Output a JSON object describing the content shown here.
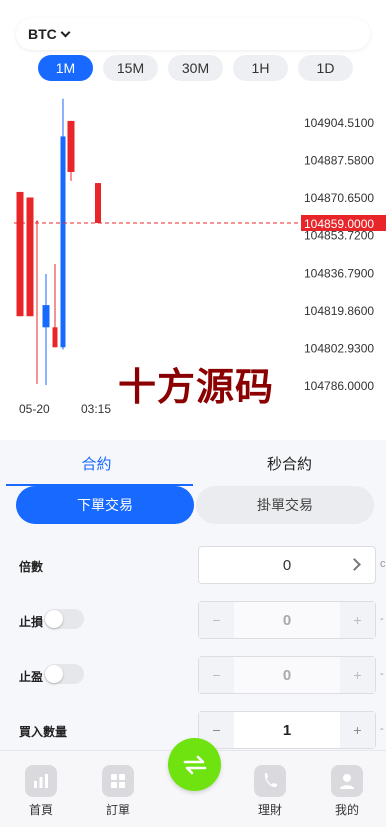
{
  "header": {
    "symbol": "BTC"
  },
  "timeframes": [
    "1M",
    "15M",
    "30M",
    "1H",
    "1D"
  ],
  "active_timeframe": "1M",
  "chart_data": {
    "type": "candlestick",
    "y_ticks": [
      "104904.5100",
      "104887.5800",
      "104870.6500",
      "104853.7200",
      "104836.7900",
      "104819.8600",
      "104802.9300",
      "104786.0000"
    ],
    "current_price": "104859.0000",
    "x_ticks": [
      "05-20",
      "03:15"
    ],
    "up_color": "#1769ff",
    "down_color": "#e8262a",
    "candles": [
      {
        "open": 104873.0,
        "close": 104817.0,
        "high": 104873.0,
        "low": 104817.0
      },
      {
        "open": 104870.5,
        "close": 104817.0,
        "high": 104870.5,
        "low": 104817.0
      },
      {
        "open": 104860.0,
        "close": 104860.0,
        "high": 104860.0,
        "low": 104786.5
      },
      {
        "open": 104812.0,
        "close": 104822.0,
        "high": 104836.0,
        "low": 104786.0
      },
      {
        "open": 104812.0,
        "close": 104803.0,
        "high": 104840.5,
        "low": 104803.0
      },
      {
        "open": 104803.0,
        "close": 104898.0,
        "high": 104915.0,
        "low": 104802.0
      },
      {
        "open": 104905.0,
        "close": 104882.0,
        "high": 104905.0,
        "low": 104878.0
      },
      {
        "open": 104877.0,
        "close": 104859.0,
        "high": 104877.0,
        "low": 104859.0
      }
    ]
  },
  "watermark": "十方源码",
  "tabs": [
    "合約",
    "秒合約"
  ],
  "order_types": [
    "下單交易",
    "掛單交易"
  ],
  "form": {
    "leverage_label": "倍數",
    "leverage_value": "0",
    "stop_loss_label": "止損",
    "stop_loss_value": "0",
    "take_profit_label": "止盈",
    "take_profit_value": "0",
    "quantity_label": "買入數量",
    "quantity_value": "1",
    "minus": "−",
    "plus": "+"
  },
  "nav": {
    "home": "首頁",
    "orders": "訂單",
    "finance": "理財",
    "mine": "我的"
  }
}
